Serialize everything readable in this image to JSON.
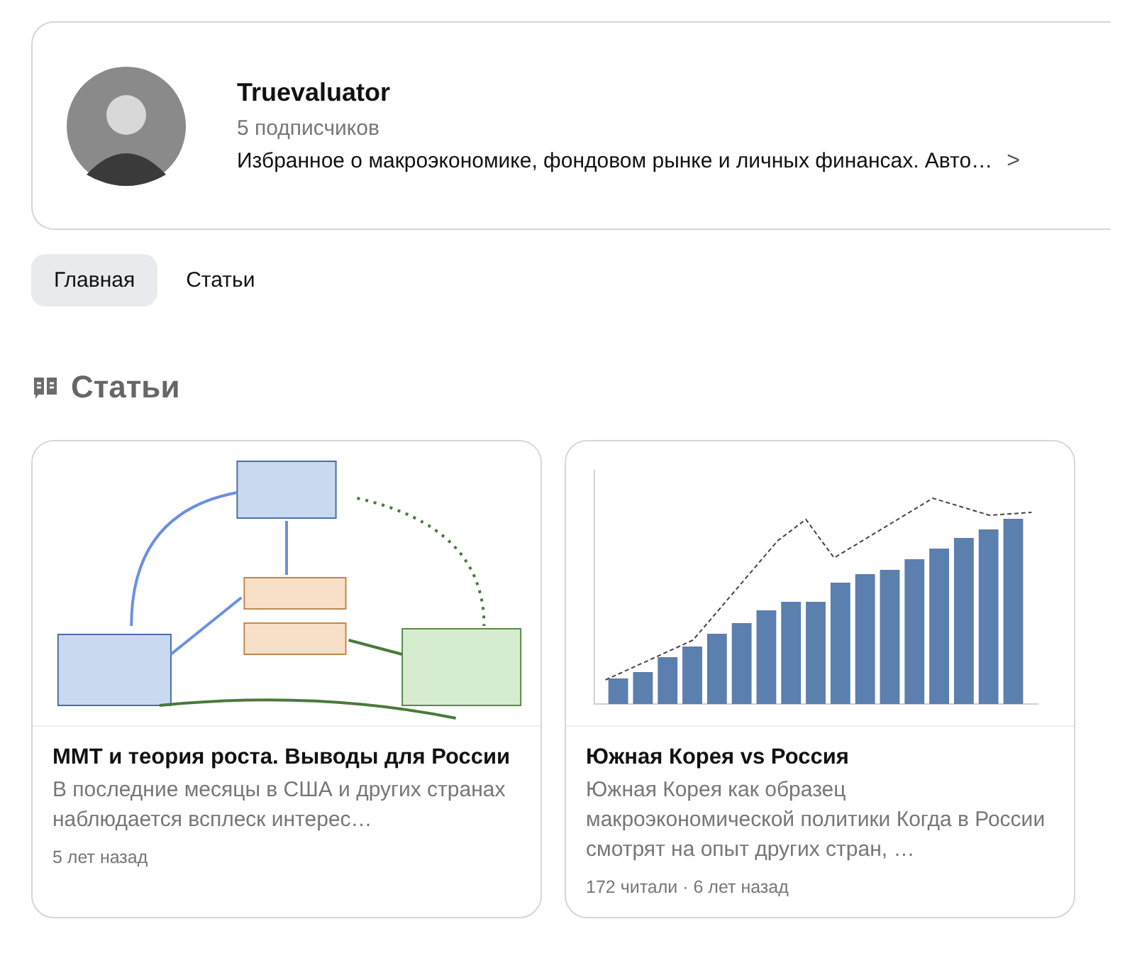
{
  "channel": {
    "name": "Truevaluator",
    "subscribers": "5 подписчиков",
    "description": "Избранное о макроэкономике, фондовом рынке и личных финансах. Авто…",
    "more_icon": ">"
  },
  "tabs": [
    {
      "label": "Главная",
      "selected": true
    },
    {
      "label": "Статьи",
      "selected": false
    }
  ],
  "section": {
    "title": "Статьи"
  },
  "articles": [
    {
      "thumbnail": {
        "kind": "diagram"
      },
      "title": "ММТ и теория роста. Выводы для России",
      "excerpt": "В последние месяцы в США и других странах наблюдается всплеск интерес…",
      "meta": "5 лет назад"
    },
    {
      "thumbnail": {
        "kind": "chart"
      },
      "title": "Южная Корея vs Россия",
      "excerpt": "Южная Корея как образец макроэкономической политики Когда в России смотрят на опыт других стран, …",
      "meta": "172 читали · 6 лет назад"
    }
  ]
}
